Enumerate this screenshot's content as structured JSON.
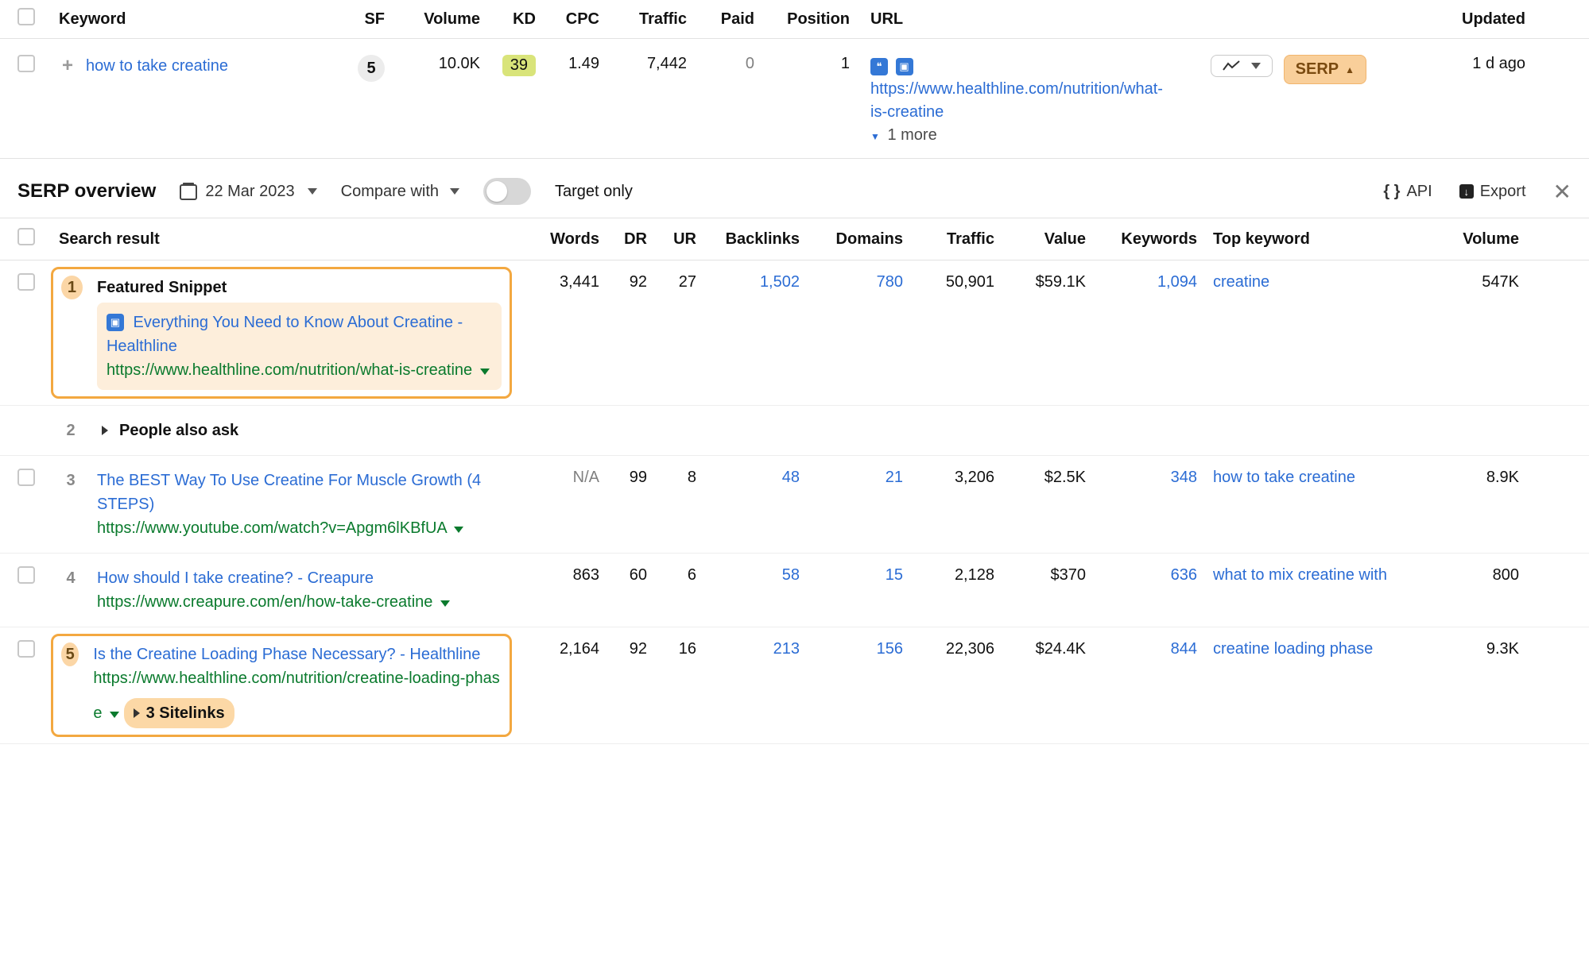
{
  "keyword_table": {
    "headers": {
      "keyword": "Keyword",
      "sf": "SF",
      "volume": "Volume",
      "kd": "KD",
      "cpc": "CPC",
      "traffic": "Traffic",
      "paid": "Paid",
      "position": "Position",
      "url": "URL",
      "updated": "Updated"
    },
    "row": {
      "keyword": "how to take creatine",
      "sf": "5",
      "volume": "10.0K",
      "kd": "39",
      "cpc": "1.49",
      "traffic": "7,442",
      "paid": "0",
      "position": "1",
      "url": "https://www.healthline.com/nutrition/what-is-creatine",
      "more": "1 more",
      "serp_btn": "SERP",
      "updated": "1 d ago"
    }
  },
  "serp_bar": {
    "title": "SERP overview",
    "date": "22 Mar 2023",
    "compare": "Compare with",
    "target_only": "Target only",
    "api": "API",
    "export": "Export"
  },
  "serp_headers": {
    "search_result": "Search result",
    "words": "Words",
    "dr": "DR",
    "ur": "UR",
    "backlinks": "Backlinks",
    "domains": "Domains",
    "traffic": "Traffic",
    "value": "Value",
    "keywords": "Keywords",
    "top_keyword": "Top keyword",
    "volume": "Volume"
  },
  "results": [
    {
      "pos": "1",
      "highlight": true,
      "featured": true,
      "featured_label": "Featured Snippet",
      "title": "Everything You Need to Know About Creatine - Healthline",
      "url": "https://www.healthline.com/nutrition/what-is-creatine",
      "words": "3,441",
      "dr": "92",
      "ur": "27",
      "backlinks": "1,502",
      "domains": "780",
      "traffic": "50,901",
      "value": "$59.1K",
      "keywords": "1,094",
      "top_keyword": "creatine",
      "volume": "547K"
    },
    {
      "pos": "2",
      "paa": true,
      "paa_label": "People also ask"
    },
    {
      "pos": "3",
      "title": "The BEST Way To Use Creatine For Muscle Growth (4 STEPS)",
      "url": "https://www.youtube.com/watch?v=Apgm6lKBfUA",
      "words": "N/A",
      "dr": "99",
      "ur": "8",
      "backlinks": "48",
      "domains": "21",
      "traffic": "3,206",
      "value": "$2.5K",
      "keywords": "348",
      "top_keyword": "how to take creatine",
      "volume": "8.9K"
    },
    {
      "pos": "4",
      "title": "How should I take creatine? - Creapure",
      "url": "https://www.creapure.com/en/how-take-creatine",
      "words": "863",
      "dr": "60",
      "ur": "6",
      "backlinks": "58",
      "domains": "15",
      "traffic": "2,128",
      "value": "$370",
      "keywords": "636",
      "top_keyword": "what to mix creatine with",
      "volume": "800"
    },
    {
      "pos": "5",
      "highlight": true,
      "title": "Is the Creatine Loading Phase Necessary? - Healthline",
      "url": "https://www.healthline.com/nutrition/creatine-loading-phase",
      "sitelinks": "3 Sitelinks",
      "words": "2,164",
      "dr": "92",
      "ur": "16",
      "backlinks": "213",
      "domains": "156",
      "traffic": "22,306",
      "value": "$24.4K",
      "keywords": "844",
      "top_keyword": "creatine loading phase",
      "volume": "9.3K"
    }
  ]
}
